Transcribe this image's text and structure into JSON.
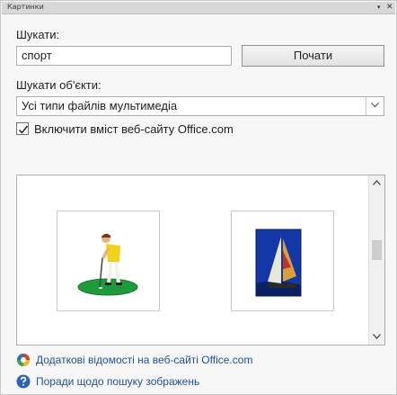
{
  "pane": {
    "title": "Картинки",
    "dropdown_glyph": "▾",
    "close_glyph": "✕"
  },
  "search": {
    "label": "Шукати:",
    "value": "спорт",
    "go_button": "Почати"
  },
  "search_in": {
    "label": "Шукати об'єкти:",
    "selected": "Усі типи файлів мультимедіа"
  },
  "include_office": {
    "label": "Включити вміст веб-сайту Office.com",
    "checked": true
  },
  "results": {
    "items": [
      {
        "icon": "golfer-clipart"
      },
      {
        "icon": "sailboat-photo"
      }
    ]
  },
  "links": {
    "more_info": "Додаткові відомості на веб-сайті Office.com",
    "tips": "Поради щодо пошуку зображень"
  }
}
